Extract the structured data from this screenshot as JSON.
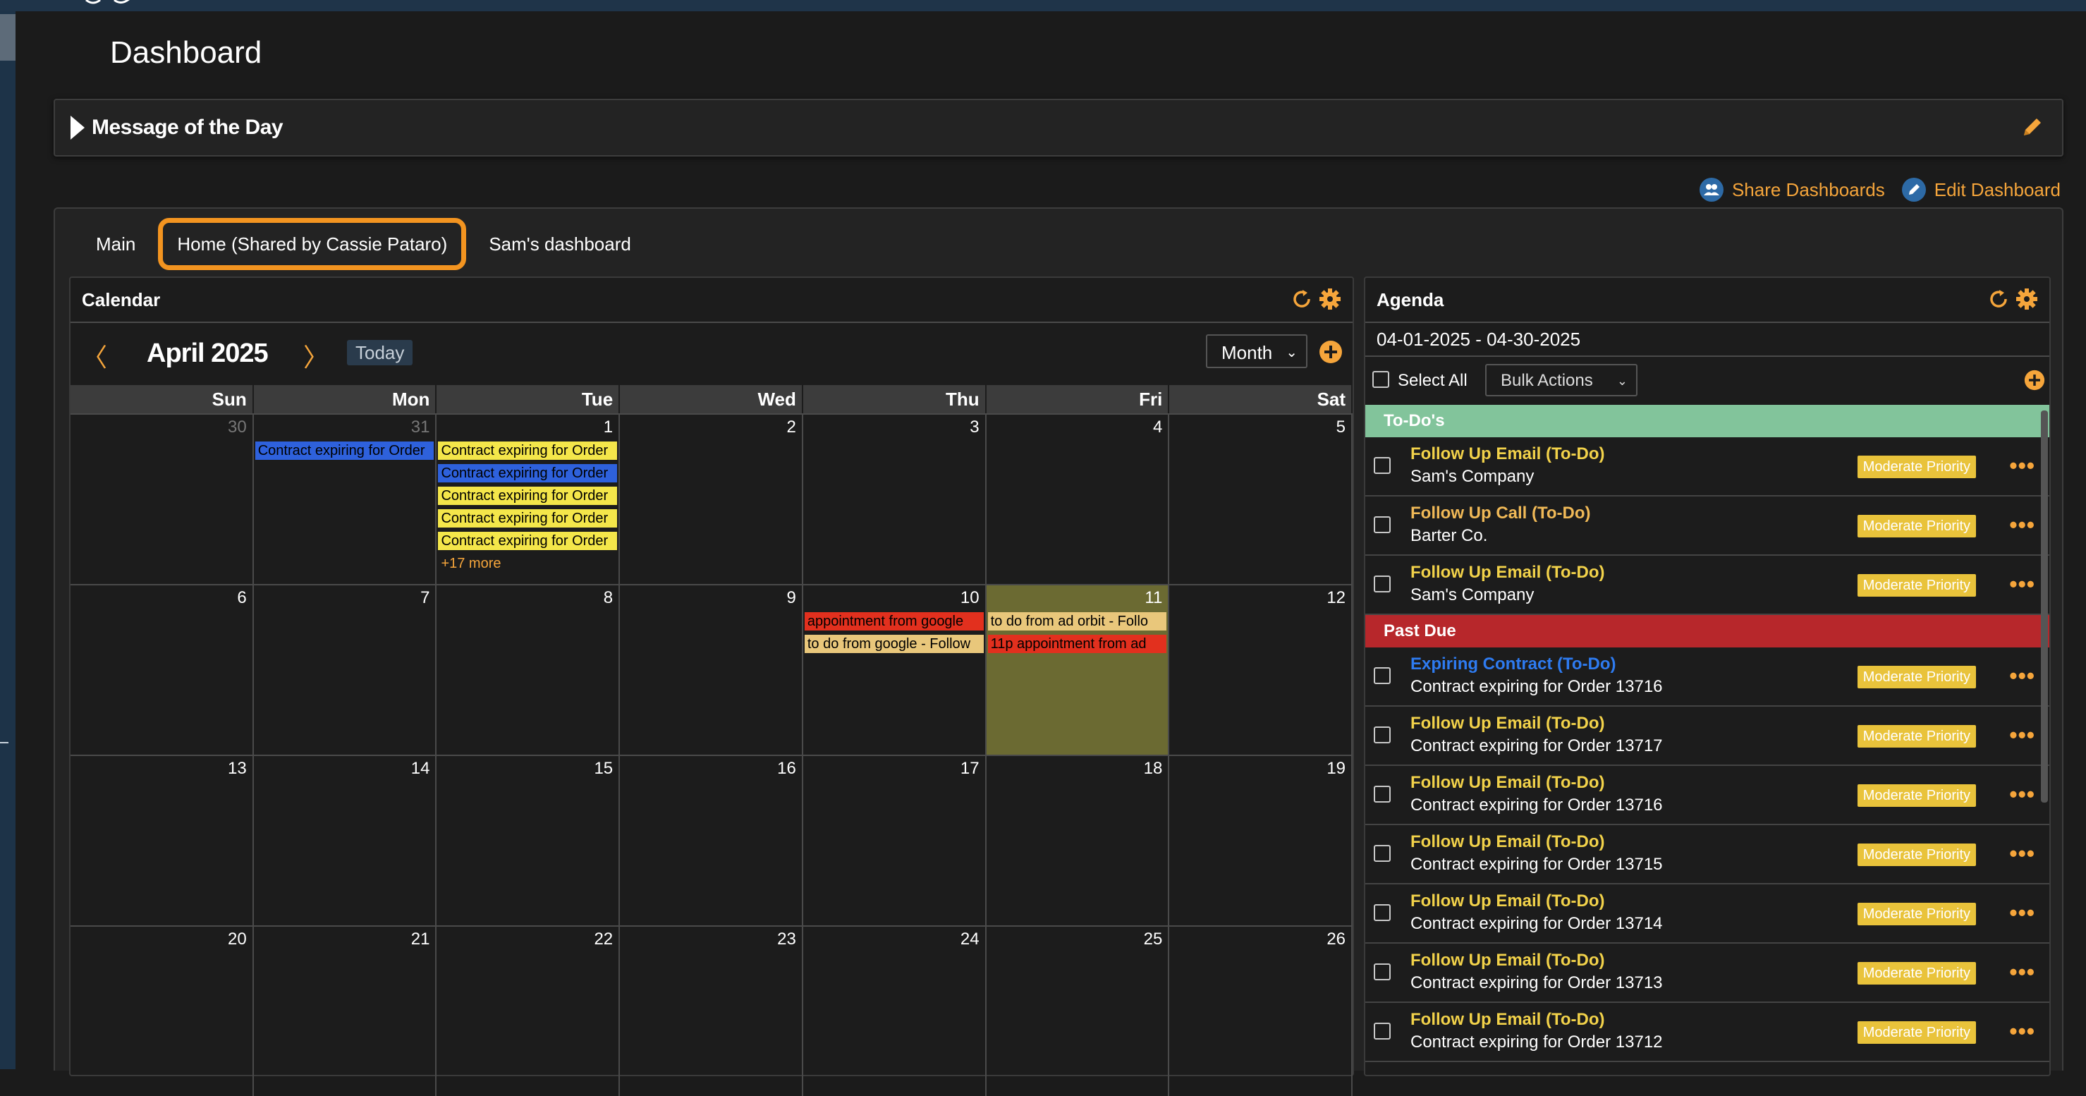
{
  "page": {
    "title": "Dashboard"
  },
  "motd": {
    "label": "Message of the Day"
  },
  "actions": {
    "share": "Share Dashboards",
    "edit": "Edit Dashboard"
  },
  "tabs": [
    {
      "label": "Main"
    },
    {
      "label": "Home (Shared by Cassie Pataro)"
    },
    {
      "label": "Sam's dashboard"
    }
  ],
  "calendar": {
    "title": "Calendar",
    "month": "April 2025",
    "prev": "〈",
    "next": "〉",
    "today": "Today",
    "view": "Month",
    "dow": [
      "Sun",
      "Mon",
      "Tue",
      "Wed",
      "Thu",
      "Fri",
      "Sat"
    ],
    "weeks": [
      [
        "30",
        "31",
        "1",
        "2",
        "3",
        "4",
        "5"
      ],
      [
        "6",
        "7",
        "8",
        "9",
        "10",
        "11",
        "12"
      ],
      [
        "13",
        "14",
        "15",
        "16",
        "17",
        "18",
        "19"
      ],
      [
        "20",
        "21",
        "22",
        "23",
        "24",
        "25",
        "26"
      ]
    ],
    "events": {
      "mon31": "Contract expiring for Order",
      "tue1": [
        "Contract expiring for Order",
        "Contract expiring for Order",
        "Contract expiring for Order",
        "Contract expiring for Order",
        "Contract expiring for Order"
      ],
      "more": "+17 more",
      "thu10": [
        "appointment from google",
        "to do from google - Follow"
      ],
      "fri11": [
        "to do from ad orbit - Follo",
        "11p appointment from ad"
      ]
    },
    "colors": {
      "yellow": "#f4e64a",
      "blue": "#2e61dc",
      "red": "#e2301e",
      "tan": "#e9c77b",
      "highlight": "#6b6a32"
    }
  },
  "agenda": {
    "title": "Agenda",
    "range": "04-01-2025 - 04-30-2025",
    "select_all": "Select All",
    "bulk": "Bulk Actions",
    "groups": {
      "todo": "To-Do's",
      "past": "Past Due"
    },
    "todo_items": [
      {
        "title": "Follow Up Email (To-Do)",
        "sub": "Sam's Company",
        "badge": "Moderate Priority"
      },
      {
        "title": "Follow Up Call (To-Do)",
        "sub": "Barter Co.",
        "badge": "Moderate Priority"
      },
      {
        "title": "Follow Up Email (To-Do)",
        "sub": "Sam's Company",
        "badge": "Moderate Priority"
      }
    ],
    "past_items": [
      {
        "title": "Expiring Contract (To-Do)",
        "sub": "Contract expiring for Order 13716",
        "badge": "Moderate Priority"
      },
      {
        "title": "Follow Up Email (To-Do)",
        "sub": "Contract expiring for Order 13717",
        "badge": "Moderate Priority"
      },
      {
        "title": "Follow Up Email (To-Do)",
        "sub": "Contract expiring for Order 13716",
        "badge": "Moderate Priority"
      },
      {
        "title": "Follow Up Email (To-Do)",
        "sub": "Contract expiring for Order 13715",
        "badge": "Moderate Priority"
      },
      {
        "title": "Follow Up Email (To-Do)",
        "sub": "Contract expiring for Order 13714",
        "badge": "Moderate Priority"
      },
      {
        "title": "Follow Up Email (To-Do)",
        "sub": "Contract expiring for Order 13713",
        "badge": "Moderate Priority"
      },
      {
        "title": "Follow Up Email (To-Do)",
        "sub": "Contract expiring for Order 13712",
        "badge": "Moderate Priority"
      }
    ],
    "dots": "•••"
  },
  "icons": {
    "pencil": "pencil-icon",
    "share": "users-icon",
    "edit": "edit-icon",
    "refresh": "refresh-icon",
    "gear": "gear-icon",
    "add": "plus-circle-icon",
    "accent": "#f5a53b"
  }
}
